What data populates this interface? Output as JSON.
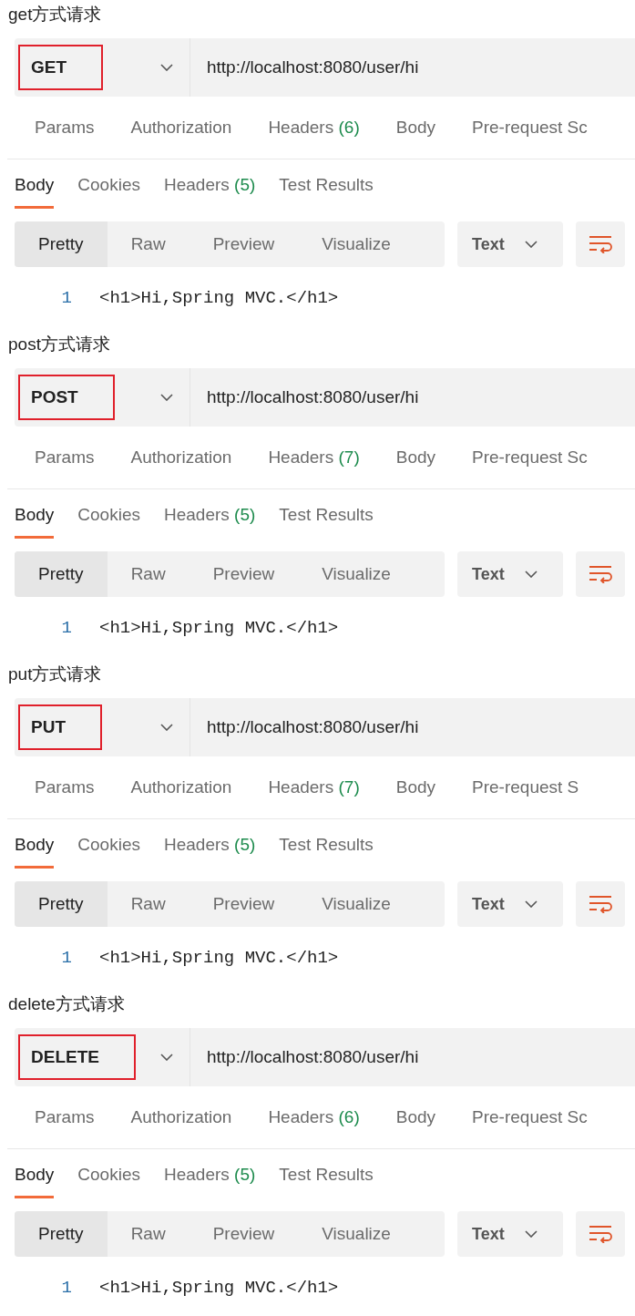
{
  "sections": [
    {
      "heading": "get方式请求",
      "method": "GET",
      "highlighted": true,
      "url": "http://localhost:8080/user/hi",
      "request_tabs": [
        {
          "label": "Params"
        },
        {
          "label": "Authorization"
        },
        {
          "label": "Headers",
          "count": "(6)"
        },
        {
          "label": "Body"
        },
        {
          "label": "Pre-request Sc"
        }
      ],
      "response_tabs": [
        {
          "label": "Body",
          "selected": true
        },
        {
          "label": "Cookies",
          "selected": false
        },
        {
          "label": "Headers",
          "count": "(5)",
          "selected": false
        },
        {
          "label": "Test Results",
          "selected": false
        }
      ],
      "view_tabs": [
        {
          "label": "Pretty",
          "selected": true
        },
        {
          "label": "Raw",
          "selected": false
        },
        {
          "label": "Preview",
          "selected": false
        },
        {
          "label": "Visualize",
          "selected": false
        }
      ],
      "format": "Text",
      "lines": [
        {
          "number": "1",
          "code": "<h1>Hi,Spring MVC.</h1>"
        }
      ]
    },
    {
      "heading": "post方式请求",
      "method": "POST",
      "highlighted": true,
      "url": "http://localhost:8080/user/hi",
      "request_tabs": [
        {
          "label": "Params"
        },
        {
          "label": "Authorization"
        },
        {
          "label": "Headers",
          "count": "(7)"
        },
        {
          "label": "Body"
        },
        {
          "label": "Pre-request Sc"
        }
      ],
      "response_tabs": [
        {
          "label": "Body",
          "selected": true
        },
        {
          "label": "Cookies",
          "selected": false
        },
        {
          "label": "Headers",
          "count": "(5)",
          "selected": false
        },
        {
          "label": "Test Results",
          "selected": false
        }
      ],
      "view_tabs": [
        {
          "label": "Pretty",
          "selected": true
        },
        {
          "label": "Raw",
          "selected": false
        },
        {
          "label": "Preview",
          "selected": false
        },
        {
          "label": "Visualize",
          "selected": false
        }
      ],
      "format": "Text",
      "lines": [
        {
          "number": "1",
          "code": "<h1>Hi,Spring MVC.</h1>"
        }
      ]
    },
    {
      "heading": "put方式请求",
      "method": "PUT",
      "highlighted": true,
      "url": "http://localhost:8080/user/hi",
      "request_tabs": [
        {
          "label": "Params"
        },
        {
          "label": "Authorization"
        },
        {
          "label": "Headers",
          "count": "(7)"
        },
        {
          "label": "Body"
        },
        {
          "label": "Pre-request S"
        }
      ],
      "response_tabs": [
        {
          "label": "Body",
          "selected": true
        },
        {
          "label": "Cookies",
          "selected": false
        },
        {
          "label": "Headers",
          "count": "(5)",
          "selected": false
        },
        {
          "label": "Test Results",
          "selected": false
        }
      ],
      "view_tabs": [
        {
          "label": "Pretty",
          "selected": true
        },
        {
          "label": "Raw",
          "selected": false
        },
        {
          "label": "Preview",
          "selected": false
        },
        {
          "label": "Visualize",
          "selected": false
        }
      ],
      "format": "Text",
      "lines": [
        {
          "number": "1",
          "code": "<h1>Hi,Spring MVC.</h1>"
        }
      ]
    },
    {
      "heading": "delete方式请求",
      "method": "DELETE",
      "highlighted": true,
      "url": "http://localhost:8080/user/hi",
      "request_tabs": [
        {
          "label": "Params"
        },
        {
          "label": "Authorization"
        },
        {
          "label": "Headers",
          "count": "(6)"
        },
        {
          "label": "Body"
        },
        {
          "label": "Pre-request Sc"
        }
      ],
      "response_tabs": [
        {
          "label": "Body",
          "selected": true
        },
        {
          "label": "Cookies",
          "selected": false
        },
        {
          "label": "Headers",
          "count": "(5)",
          "selected": false
        },
        {
          "label": "Test Results",
          "selected": false
        }
      ],
      "view_tabs": [
        {
          "label": "Pretty",
          "selected": true
        },
        {
          "label": "Raw",
          "selected": false
        },
        {
          "label": "Preview",
          "selected": false
        },
        {
          "label": "Visualize",
          "selected": false
        }
      ],
      "format": "Text",
      "lines": [
        {
          "number": "1",
          "code": "<h1>Hi,Spring MVC.</h1>"
        }
      ]
    }
  ]
}
